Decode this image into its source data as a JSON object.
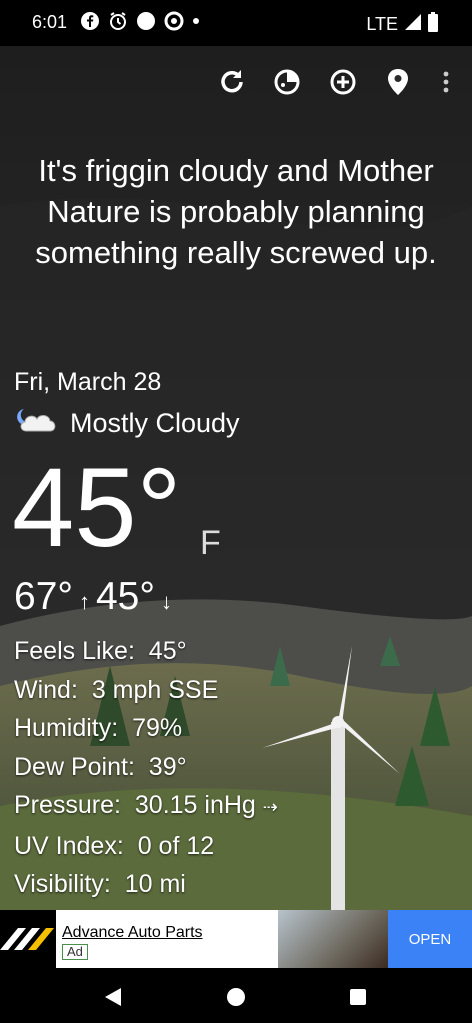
{
  "status_bar": {
    "time": "6:01",
    "notification_icons": [
      "facebook-icon",
      "alarm-icon",
      "circle-icon",
      "chrome-icon",
      "dot-icon"
    ],
    "network": "LTE"
  },
  "toolbar": {
    "buttons": [
      "refresh-icon",
      "radar-icon",
      "add-location-icon",
      "location-pin-icon",
      "more-options-icon"
    ]
  },
  "headline": "It's friggin cloudy and Mother Nature is probably planning something really screwed up.",
  "weather": {
    "date": "Fri, March 28",
    "condition": "Mostly Cloudy",
    "condition_icon": "mostly-cloudy-night-icon",
    "temperature": "45°",
    "unit": "F",
    "high": "67°",
    "low": "45°"
  },
  "details": [
    {
      "label": "Feels Like:",
      "value": "45°"
    },
    {
      "label": "Wind:",
      "value": "3 mph SSE"
    },
    {
      "label": "Humidity:",
      "value": "79%"
    },
    {
      "label": "Dew Point:",
      "value": "39°"
    },
    {
      "label": "Pressure:",
      "value": "30.15 inHg"
    },
    {
      "label": "UV Index:",
      "value": "0 of 12"
    },
    {
      "label": "Visibility:",
      "value": "10 mi"
    }
  ],
  "ad": {
    "title": "Advance Auto Parts",
    "badge": "Ad",
    "button": "OPEN"
  },
  "colors": {
    "background": "#1c1c1c",
    "status_bar": "#000000",
    "ad_button": "#3b82f6"
  }
}
